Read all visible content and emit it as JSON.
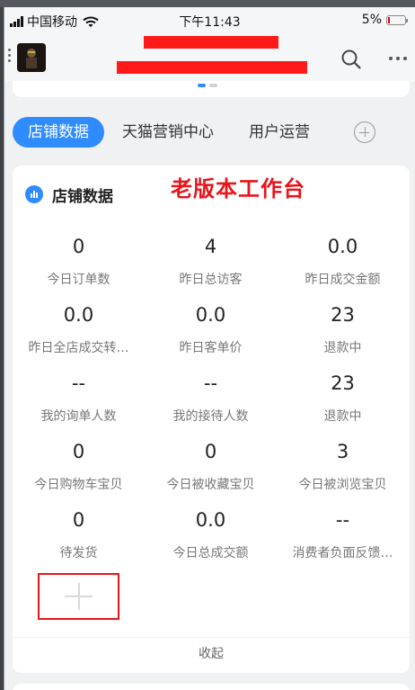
{
  "status_bar": {
    "carrier": "中国移动",
    "time": "下午11:43",
    "battery": "5%",
    "battery_level": 0.05,
    "battery_color": "#e60012"
  },
  "header": {
    "more_icon": "more-icon",
    "search_icon": "search-icon"
  },
  "tabs": [
    {
      "label": "店铺数据",
      "active": true
    },
    {
      "label": "天猫营销中心",
      "active": false
    },
    {
      "label": "用户运营",
      "active": false
    }
  ],
  "annotation": "老版本工作台",
  "card": {
    "title": "店铺数据",
    "metrics": [
      {
        "value": "0",
        "label": "今日订单数"
      },
      {
        "value": "4",
        "label": "昨日总访客"
      },
      {
        "value": "0.0",
        "label": "昨日成交金额"
      },
      {
        "value": "0.0",
        "label": "昨日全店成交转…"
      },
      {
        "value": "0.0",
        "label": "昨日客单价"
      },
      {
        "value": "23",
        "label": "退款中"
      },
      {
        "value": "--",
        "label": "我的询单人数"
      },
      {
        "value": "--",
        "label": "我的接待人数"
      },
      {
        "value": "23",
        "label": "退款中"
      },
      {
        "value": "0",
        "label": "今日购物车宝贝"
      },
      {
        "value": "0",
        "label": "今日被收藏宝贝"
      },
      {
        "value": "3",
        "label": "今日被浏览宝贝"
      },
      {
        "value": "0",
        "label": "待发货"
      },
      {
        "value": "0.0",
        "label": "今日总成交额"
      },
      {
        "value": "--",
        "label": "消费者负面反馈…"
      }
    ],
    "collapse_label": "收起"
  },
  "colors": {
    "accent": "#2f8cff",
    "annotation_red": "#e8151b"
  }
}
